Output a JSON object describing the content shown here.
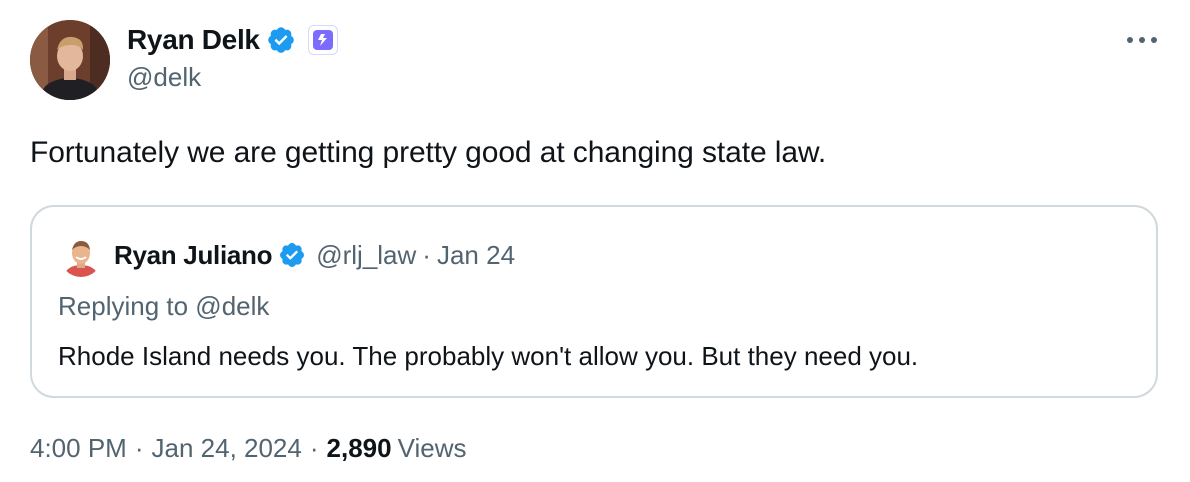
{
  "author": {
    "name": "Ryan Delk",
    "handle": "@delk",
    "verified": true,
    "affiliate_badge_icon": "lightning-affiliate-icon"
  },
  "menu_icon": "more-horizontal-icon",
  "tweet_text": "Fortunately we are getting pretty good at changing state law.",
  "quoted_tweet": {
    "name": "Ryan Juliano",
    "handle": "@rlj_law",
    "separator": "·",
    "date": "Jan 24",
    "replying_to": "Replying to @delk",
    "text": "Rhode Island needs you. The probably won't allow you. But they need you."
  },
  "meta": {
    "time": "4:00 PM",
    "separator": "·",
    "date": "Jan 24, 2024",
    "views_count": "2,890",
    "views_label": "Views"
  },
  "colors": {
    "verified_blue": "#1d9bf0",
    "secondary_text": "#536471",
    "border": "#cfd9de",
    "affiliate_purple": "#6f64ff"
  }
}
